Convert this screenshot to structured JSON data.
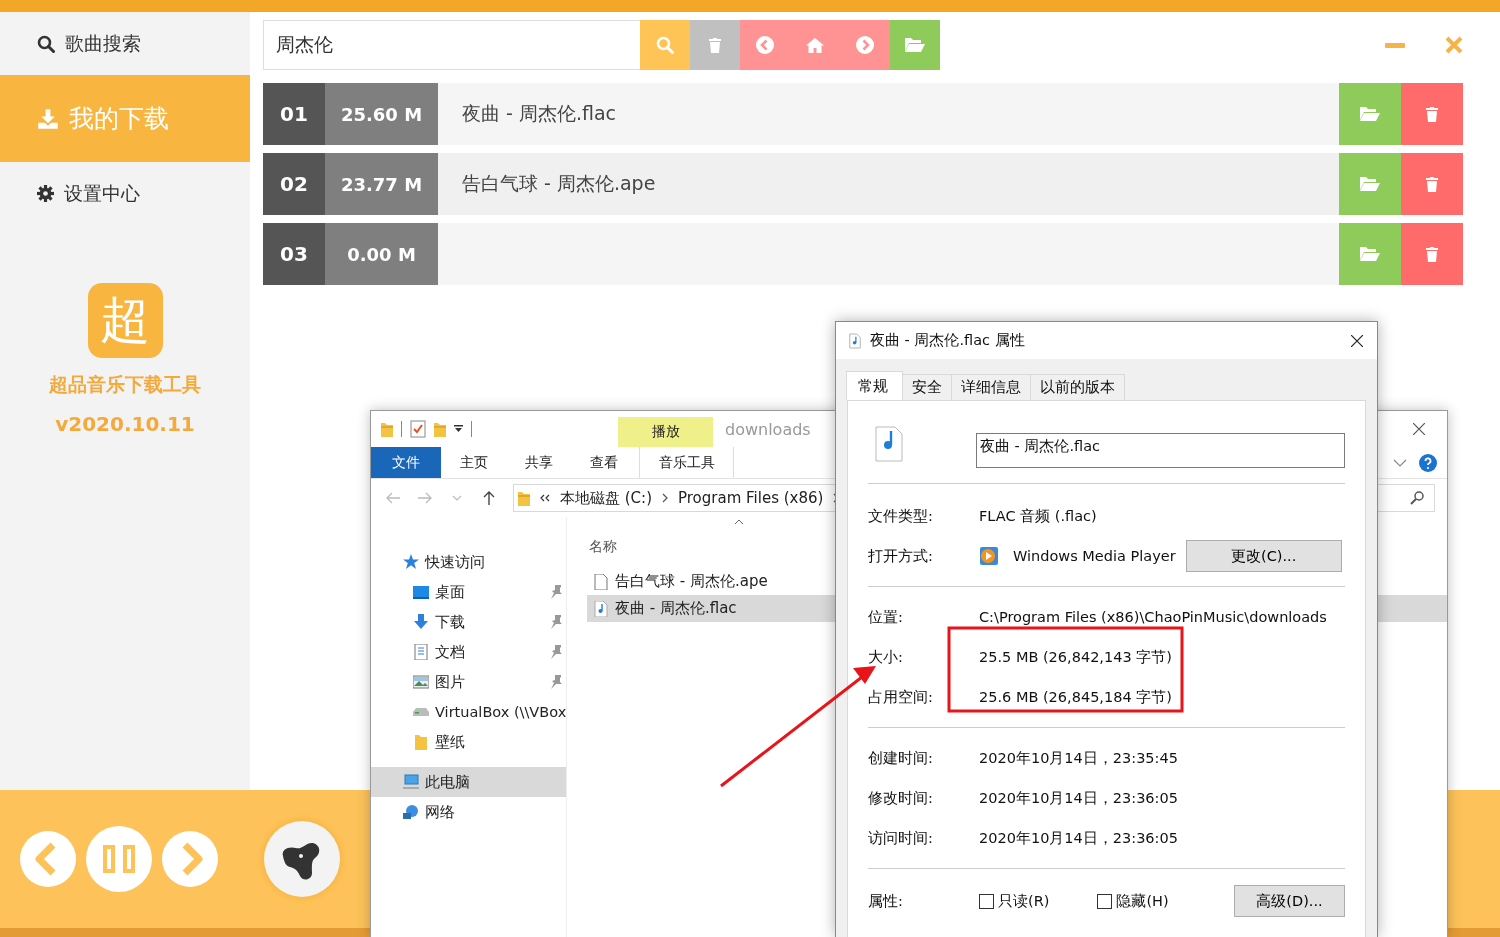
{
  "app": {
    "sidebar": {
      "items": [
        {
          "label": "歌曲搜索",
          "kind": "search",
          "selected": false
        },
        {
          "label": "我的下载",
          "kind": "download",
          "selected": true
        },
        {
          "label": "设置中心",
          "kind": "settings",
          "selected": false
        }
      ],
      "logo_char": "超",
      "app_name": "超品音乐下载工具",
      "version": "v2020.10.11"
    },
    "search": {
      "value": "周杰伦"
    },
    "downloads": [
      {
        "number": "01",
        "size": "25.60 M",
        "name": "夜曲 - 周杰伦.flac"
      },
      {
        "number": "02",
        "size": "23.77 M",
        "name": "告白气球 - 周杰伦.ape"
      },
      {
        "number": "03",
        "size": "0.00 M"
      }
    ],
    "player": {
      "playing": true
    }
  },
  "explorer": {
    "contextual_group": "播放",
    "title": "downloads",
    "ribbon_tabs": [
      {
        "label": "文件",
        "kind": "file"
      },
      {
        "label": "主页",
        "kind": "tab"
      },
      {
        "label": "共享",
        "kind": "tab"
      },
      {
        "label": "查看",
        "kind": "tab"
      },
      {
        "label": "音乐工具",
        "kind": "contextual"
      }
    ],
    "breadcrumb": [
      "本地磁盘 (C:)",
      "Program Files (x86)"
    ],
    "nav": [
      {
        "label": "快速访问",
        "kind": "star",
        "selected": false,
        "children": [
          {
            "label": "桌面",
            "kind": "desktop",
            "pinned": true,
            "selected": false
          },
          {
            "label": "下载",
            "kind": "download",
            "pinned": true,
            "selected": false
          },
          {
            "label": "文档",
            "kind": "document",
            "pinned": true,
            "selected": false
          },
          {
            "label": "图片",
            "kind": "picture",
            "pinned": true,
            "selected": false
          },
          {
            "label": "VirtualBox (\\\\VBox",
            "kind": "drive",
            "pinned": false,
            "selected": false
          },
          {
            "label": "壁纸",
            "kind": "folder",
            "pinned": false,
            "selected": false
          }
        ]
      },
      {
        "label": "此电脑",
        "kind": "pc",
        "selected": true
      },
      {
        "label": "网络",
        "kind": "network",
        "selected": false
      }
    ],
    "column": "名称",
    "files": [
      {
        "name": "告白气球 - 周杰伦.ape",
        "kind": "file",
        "selected": false
      },
      {
        "name": "夜曲 - 周杰伦.flac",
        "kind": "audio",
        "selected": true
      }
    ]
  },
  "properties": {
    "title": "夜曲 - 周杰伦.flac 属性",
    "tabs": [
      {
        "label": "常规",
        "selected": true
      },
      {
        "label": "安全",
        "selected": false
      },
      {
        "label": "详细信息",
        "selected": false
      },
      {
        "label": "以前的版本",
        "selected": false
      }
    ],
    "file_name": "夜曲 - 周杰伦.flac",
    "sections": [
      [
        {
          "label": "文件类型:",
          "value": "FLAC 音频 (.flac)"
        },
        {
          "label": "打开方式:",
          "value": "Windows Media Player",
          "button": "更改(C)..."
        }
      ],
      [
        {
          "label": "位置:",
          "value": "C:\\Program Files (x86)\\ChaoPinMusic\\downloads"
        },
        {
          "label": "大小:",
          "value": "25.5 MB (26,842,143 字节)"
        },
        {
          "label": "占用空间:",
          "value": "25.6 MB (26,845,184 字节)"
        }
      ],
      [
        {
          "label": "创建时间:",
          "value": "2020年10月14日，23:35:45"
        },
        {
          "label": "修改时间:",
          "value": "2020年10月14日，23:36:05"
        },
        {
          "label": "访问时间:",
          "value": "2020年10月14日，23:36:05"
        }
      ]
    ],
    "attributes": {
      "label": "属性:",
      "checkboxes": [
        {
          "label": "只读(R)",
          "checked": false
        },
        {
          "label": "隐藏(H)",
          "checked": false
        }
      ],
      "button": "高级(D)..."
    }
  }
}
